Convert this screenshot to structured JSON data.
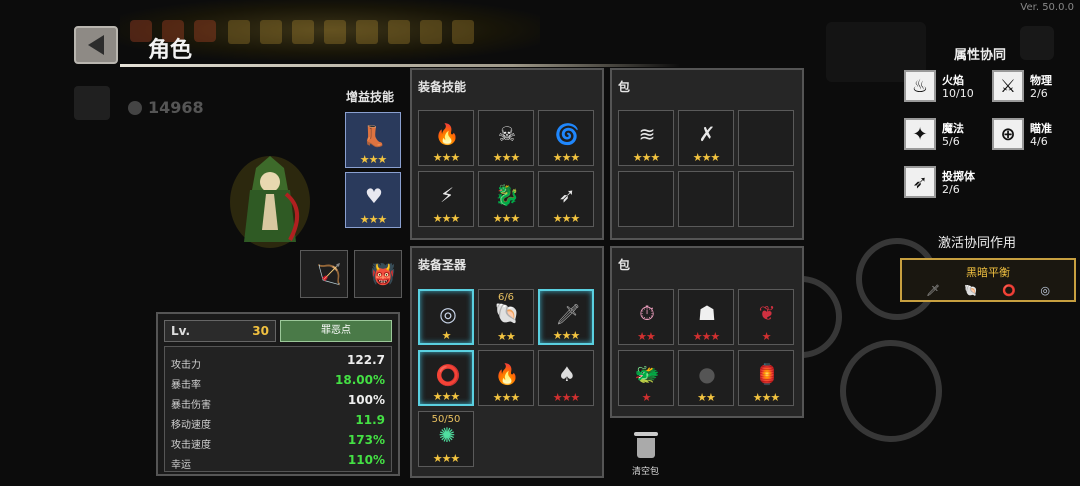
{
  "version": "Ver. 50.0.0",
  "header": {
    "title": "角色"
  },
  "gold": "14968",
  "boost_skills": {
    "label": "增益技能",
    "slots": [
      {
        "icon": "boot-icon",
        "stars": "★★★"
      },
      {
        "icon": "heart-wing-icon",
        "stars": "★★★"
      }
    ]
  },
  "equipped_gear": [
    {
      "icon": "bow-icon"
    },
    {
      "icon": "blue-demon-icon"
    }
  ],
  "equip_skills": {
    "title": "装备技能",
    "slots": [
      {
        "icon": "flame-figure-icon",
        "stars": "★★★"
      },
      {
        "icon": "reaper-icon",
        "stars": "★★★"
      },
      {
        "icon": "vortex-icon",
        "stars": "★★★"
      },
      {
        "icon": "lightning-burst-icon",
        "stars": "★★★"
      },
      {
        "icon": "dragon-icon",
        "stars": "★★★"
      },
      {
        "icon": "spear-icon",
        "stars": "★★★"
      }
    ]
  },
  "skill_bag": {
    "title": "包",
    "slots": [
      {
        "icon": "wind-slash-icon",
        "stars": "★★★"
      },
      {
        "icon": "crossed-blades-icon",
        "stars": "★★★"
      },
      {
        "icon": "",
        "stars": ""
      },
      {
        "icon": "",
        "stars": ""
      },
      {
        "icon": "",
        "stars": ""
      },
      {
        "icon": "",
        "stars": ""
      }
    ]
  },
  "equip_relics": {
    "title": "装备圣器",
    "slots": [
      {
        "icon": "silver-ring-icon",
        "stars": "★",
        "count": "",
        "selected": true
      },
      {
        "icon": "pink-shell-icon",
        "stars": "★★",
        "count": "6/6",
        "selected": false
      },
      {
        "icon": "dagger-icon",
        "stars": "★★★",
        "count": "",
        "selected": true
      },
      {
        "icon": "red-ring-icon",
        "stars": "★★★",
        "count": "",
        "selected": true
      },
      {
        "icon": "fire-blade-icon",
        "stars": "★★★",
        "count": "",
        "selected": false
      },
      {
        "icon": "shadow-icon",
        "stars": "★★★",
        "count": "",
        "selected": false,
        "red": true
      },
      {
        "icon": "green-spirit-icon",
        "stars": "★★★",
        "count": "50/50",
        "selected": false
      }
    ]
  },
  "relic_bag": {
    "title": "包",
    "slots": [
      {
        "icon": "pink-clock-icon",
        "stars": "★★",
        "red": true
      },
      {
        "icon": "white-mask-icon",
        "stars": "★★★",
        "red": true
      },
      {
        "icon": "red-spirit-icon",
        "stars": "★",
        "red": true
      },
      {
        "icon": "red-dragon-icon",
        "stars": "★",
        "red": true
      },
      {
        "icon": "dark-orb-icon",
        "stars": "★★",
        "red": false
      },
      {
        "icon": "lantern-icon",
        "stars": "★★★",
        "red": false
      }
    ]
  },
  "trash": {
    "label": "清空包"
  },
  "stats": {
    "level_label": "Lv.",
    "level": "30",
    "sin_button": "罪恶点",
    "rows": [
      {
        "name": "攻击力",
        "value": "122.7",
        "green": false
      },
      {
        "name": "暴击率",
        "value": "18.00%",
        "green": true
      },
      {
        "name": "暴击伤害",
        "value": "100%",
        "green": false
      },
      {
        "name": "移动速度",
        "value": "11.9",
        "green": true
      },
      {
        "name": "攻击速度",
        "value": "173%",
        "green": true
      },
      {
        "name": "幸运",
        "value": "110%",
        "green": true
      }
    ]
  },
  "synergy": {
    "title": "属性协同",
    "items": [
      {
        "name": "火焰",
        "count": "10/10",
        "icon": "fire-icon",
        "glyph": "♨"
      },
      {
        "name": "物理",
        "count": "2/6",
        "icon": "sword-icon",
        "glyph": "⚔"
      },
      {
        "name": "魔法",
        "count": "5/6",
        "icon": "magic-star-icon",
        "glyph": "✦"
      },
      {
        "name": "瞄准",
        "count": "4/6",
        "icon": "crosshair-icon",
        "glyph": "⊕"
      },
      {
        "name": "投掷体",
        "count": "2/6",
        "icon": "projectile-icon",
        "glyph": "➶"
      }
    ]
  },
  "activated_synergy": {
    "title": "激活协同作用",
    "name": "黑暗平衡",
    "icons": [
      "dagger-icon",
      "pink-shell-icon",
      "red-ring-icon",
      "silver-ring-icon"
    ]
  }
}
